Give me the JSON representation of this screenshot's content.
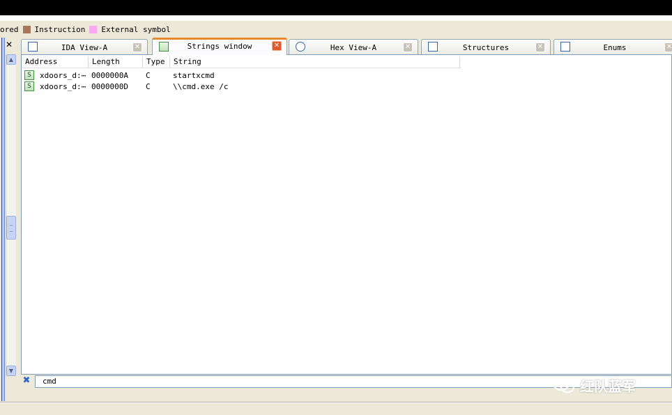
{
  "legend": {
    "items": [
      {
        "label": "ored",
        "color": ""
      },
      {
        "label": "Instruction",
        "color": "#A9765B"
      },
      {
        "label": "External symbol",
        "color": "#F7AAF1"
      }
    ]
  },
  "tabs": [
    {
      "label": "IDA View-A",
      "icon": "ida-view-icon",
      "active": false
    },
    {
      "label": "Strings window",
      "icon": "strings-icon",
      "active": true
    },
    {
      "label": "Hex View-A",
      "icon": "hex-view-icon",
      "active": false
    },
    {
      "label": "Structures",
      "icon": "structures-icon",
      "active": false
    },
    {
      "label": "Enums",
      "icon": "enums-icon",
      "active": false
    }
  ],
  "table": {
    "columns": [
      "Address",
      "Length",
      "Type",
      "String"
    ],
    "rows": [
      {
        "address": "xdoors_d:⋯",
        "length": "0000000A",
        "type": "C",
        "string": "startxcmd"
      },
      {
        "address": "xdoors_d:⋯",
        "length": "0000000D",
        "type": "C",
        "string": "\\\\cmd.exe /c"
      }
    ]
  },
  "filter": {
    "value": "cmd"
  },
  "watermark": {
    "text": "红队蓝军"
  },
  "colors": {
    "accent_tab": "#E68B2C",
    "close_active": "#E05A2E",
    "panel_border": "#7F9DB9",
    "window_bg": "#ECE9D8"
  }
}
